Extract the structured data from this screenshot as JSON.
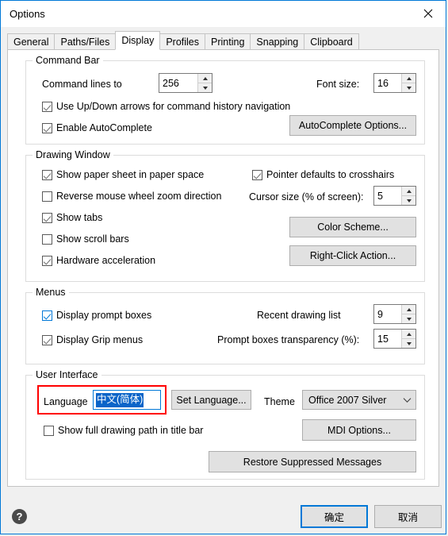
{
  "window": {
    "title": "Options",
    "close_icon": "close-icon"
  },
  "tabs": [
    {
      "label": "General",
      "active": false
    },
    {
      "label": "Paths/Files",
      "active": false
    },
    {
      "label": "Display",
      "active": true
    },
    {
      "label": "Profiles",
      "active": false
    },
    {
      "label": "Printing",
      "active": false
    },
    {
      "label": "Snapping",
      "active": false
    },
    {
      "label": "Clipboard",
      "active": false
    }
  ],
  "command_bar": {
    "legend": "Command Bar",
    "command_lines_label": "Command lines to",
    "command_lines_value": "256",
    "font_size_label": "Font size:",
    "font_size_value": "16",
    "use_updown_label": "Use Up/Down arrows for command history navigation",
    "enable_autocomplete_label": "Enable AutoComplete",
    "autocomplete_options_button": "AutoComplete Options..."
  },
  "drawing_window": {
    "legend": "Drawing Window",
    "show_paper_sheet_label": "Show paper sheet in paper space",
    "reverse_wheel_label": "Reverse mouse wheel zoom direction",
    "show_tabs_label": "Show tabs",
    "show_scroll_bars_label": "Show scroll bars",
    "hardware_accel_label": "Hardware acceleration",
    "pointer_crosshairs_label": "Pointer defaults to crosshairs",
    "cursor_size_label": "Cursor size (% of screen):",
    "cursor_size_value": "5",
    "color_scheme_button": "Color Scheme...",
    "right_click_action_button": "Right-Click Action..."
  },
  "menus": {
    "legend": "Menus",
    "display_prompt_boxes_label": "Display prompt boxes",
    "display_grip_menus_label": "Display Grip menus",
    "recent_drawing_list_label": "Recent drawing list",
    "recent_drawing_list_value": "9",
    "prompt_transparency_label": "Prompt boxes transparency (%):",
    "prompt_transparency_value": "15"
  },
  "user_interface": {
    "legend": "User Interface",
    "language_label": "Language",
    "language_value": "中文(简体)",
    "set_language_button": "Set Language...",
    "theme_label": "Theme",
    "theme_value": "Office 2007 Silver",
    "theme_arrow_icon": "chevron-down-icon",
    "show_full_path_label": "Show full drawing path in title bar",
    "mdi_options_button": "MDI Options...",
    "restore_suppressed_button": "Restore Suppressed Messages"
  },
  "footer": {
    "help_icon": "help-icon",
    "help_glyph": "?",
    "ok_button": "确定",
    "cancel_button": "取消"
  },
  "colors": {
    "accent": "#0078d7",
    "highlight_annotation": "#ff0000",
    "selection": "#0a64c8",
    "button_face": "#e1e1e1"
  }
}
